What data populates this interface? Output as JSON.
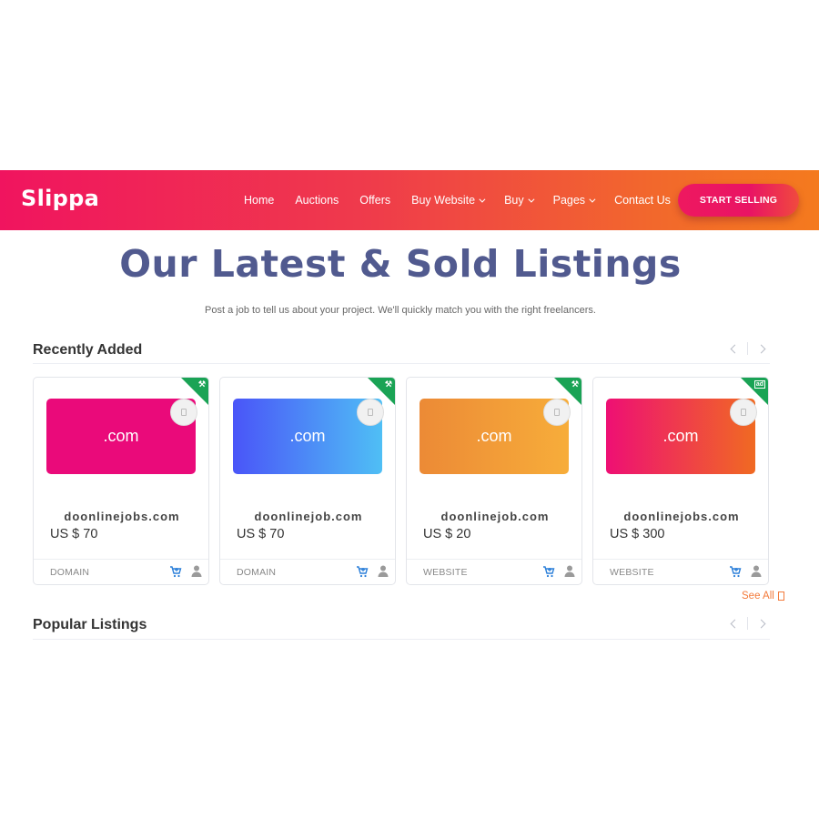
{
  "header": {
    "logo": "Slippa",
    "nav": [
      {
        "label": "Home",
        "dropdown": false
      },
      {
        "label": "Auctions",
        "dropdown": false
      },
      {
        "label": "Offers",
        "dropdown": false
      },
      {
        "label": "Buy Website",
        "dropdown": true
      },
      {
        "label": "Buy",
        "dropdown": true
      },
      {
        "label": "Pages",
        "dropdown": true
      },
      {
        "label": "Contact Us",
        "dropdown": false
      }
    ],
    "cta_label": "START SELLING"
  },
  "hero": {
    "title": "Our Latest & Sold Listings",
    "subtitle": "Post a job to tell us about your project. We'll quickly match you with the right freelancers."
  },
  "recently_added": {
    "title": "Recently Added",
    "see_all_label": "See All",
    "cards": [
      {
        "tld": ".com",
        "name": "doonlinejobs.com",
        "price": "US $ 70",
        "type": "DOMAIN",
        "badge": "auction-icon",
        "gradient": [
          "#ea0a7a",
          "#ea0a7a"
        ]
      },
      {
        "tld": ".com",
        "name": "doonlinejob.com",
        "price": "US $ 70",
        "type": "DOMAIN",
        "badge": "auction-icon",
        "gradient": [
          "#4a55f8",
          "#4fbff5"
        ]
      },
      {
        "tld": ".com",
        "name": "doonlinejob.com",
        "price": "US $ 20",
        "type": "WEBSITE",
        "badge": "auction-icon",
        "gradient": [
          "#ec8a36",
          "#f7ad3a"
        ]
      },
      {
        "tld": ".com",
        "name": "doonlinejobs.com",
        "price": "US $ 300",
        "type": "WEBSITE",
        "badge": "ad-icon",
        "gradient": [
          "#ee0f74",
          "#f06a22"
        ]
      }
    ]
  },
  "popular": {
    "title": "Popular Listings"
  },
  "colors": {
    "header_start": "#f0145f",
    "header_end": "#f47a1e",
    "hero_title": "#515a8f",
    "ribbon": "#1aa355",
    "cart_icon": "#2b7fd9",
    "see_all": "#f37a3a"
  }
}
